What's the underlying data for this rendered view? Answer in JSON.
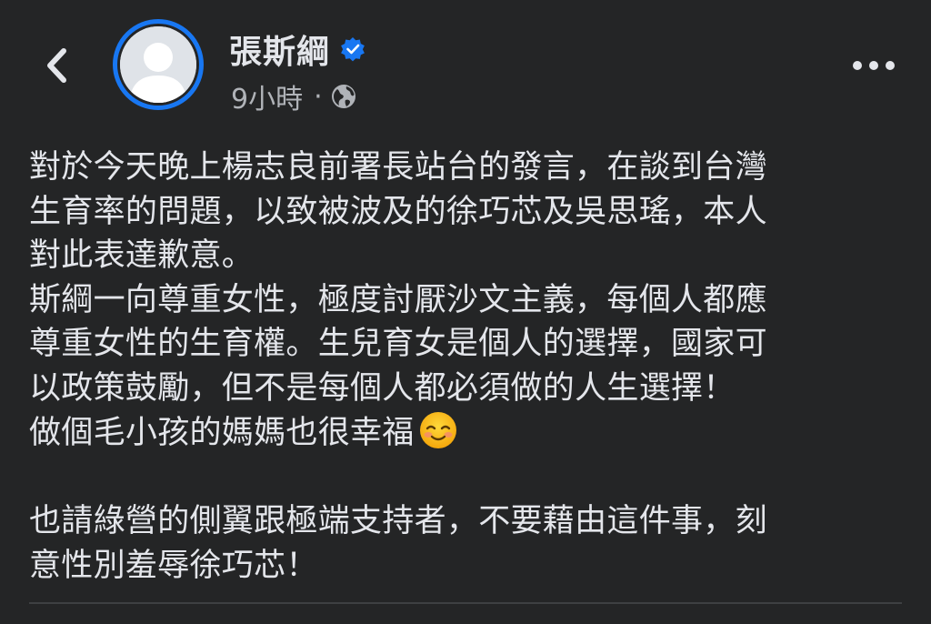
{
  "header": {
    "back_icon": "chevron-left-icon",
    "author_name": "張斯綱",
    "verified_icon": "verified-badge-icon",
    "timestamp": "9小時",
    "meta_separator": "·",
    "audience_icon": "globe-icon",
    "more_icon": "more-horizontal-icon"
  },
  "post": {
    "paragraph_1": "對於今天晚上楊志良前署長站台的發言，在談到台灣\n生育率的問題，以致被波及的徐巧芯及吳思瑤，本人\n對此表達歉意。\n斯綱一向尊重女性，極度討厭沙文主義，每個人都應\n尊重女性的生育權。生兒育女是個人的選擇，國家可\n以政策鼓勵，但不是每個人都必須做的人生選擇！\n做個毛小孩的媽媽也很幸福",
    "emoji_icon": "smiling-face-emoji-icon",
    "paragraph_2": "也請綠營的側翼跟極端支持者，不要藉由這件事，刻\n意性別羞辱徐巧芯！"
  },
  "colors": {
    "background": "#242526",
    "text_primary": "#e4e6eb",
    "text_secondary": "#b0b3b8",
    "accent_blue": "#1877f2"
  }
}
